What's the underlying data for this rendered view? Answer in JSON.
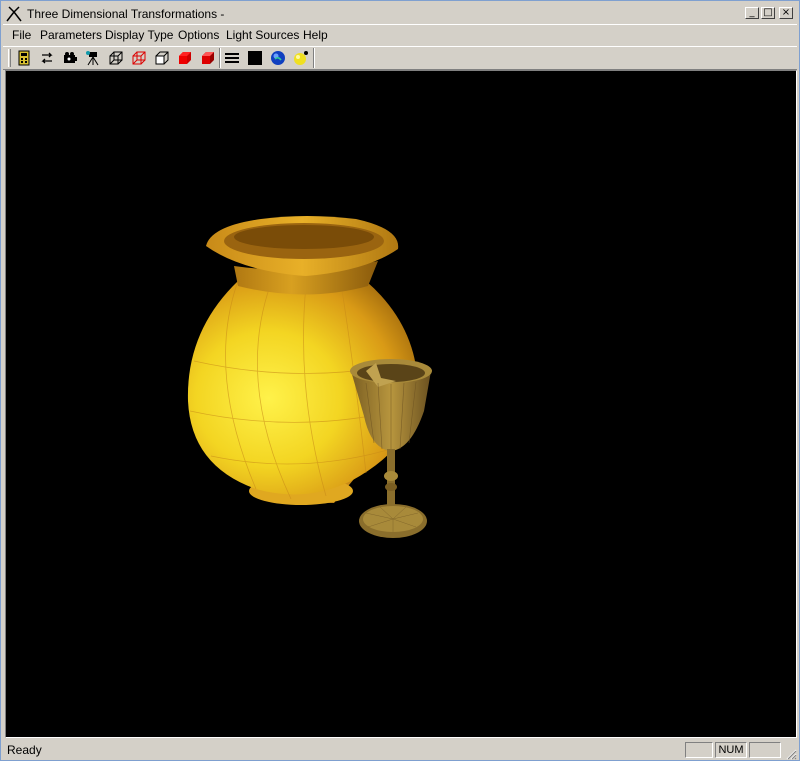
{
  "window": {
    "title": "Three Dimensional Transformations -",
    "controls": {
      "minimize": "_",
      "maximize": "□",
      "close": "×"
    }
  },
  "menu": {
    "items": [
      {
        "label": "File"
      },
      {
        "label": "Parameters"
      },
      {
        "label": "Display Type"
      },
      {
        "label": "Options"
      },
      {
        "label": "Light Sources"
      },
      {
        "label": "Help"
      }
    ]
  },
  "toolbar": {
    "buttons": [
      {
        "icon": "calculator-icon"
      },
      {
        "icon": "rotate-icon"
      },
      {
        "icon": "camera-icon"
      },
      {
        "icon": "tripod-camera-icon"
      },
      {
        "icon": "wireframe-cube-icon"
      },
      {
        "icon": "red-wireframe-cube-icon"
      },
      {
        "icon": "hidden-line-cube-icon"
      },
      {
        "icon": "solid-red-cube-icon"
      },
      {
        "icon": "shaded-red-cube-icon"
      },
      {
        "icon": "lines-icon"
      },
      {
        "icon": "black-square-icon"
      },
      {
        "icon": "blue-sphere-icon"
      },
      {
        "icon": "yellow-sphere-light-icon"
      }
    ]
  },
  "scene": {
    "background": "#000000",
    "objects": [
      "vase",
      "goblet"
    ],
    "colors": {
      "vase_bright": "#f5e52a",
      "vase_mid": "#e0a81c",
      "vase_dark": "#9a6410",
      "goblet": "#a88a3a"
    }
  },
  "status": {
    "text": "Ready",
    "indicators": [
      "",
      "NUM",
      ""
    ]
  }
}
